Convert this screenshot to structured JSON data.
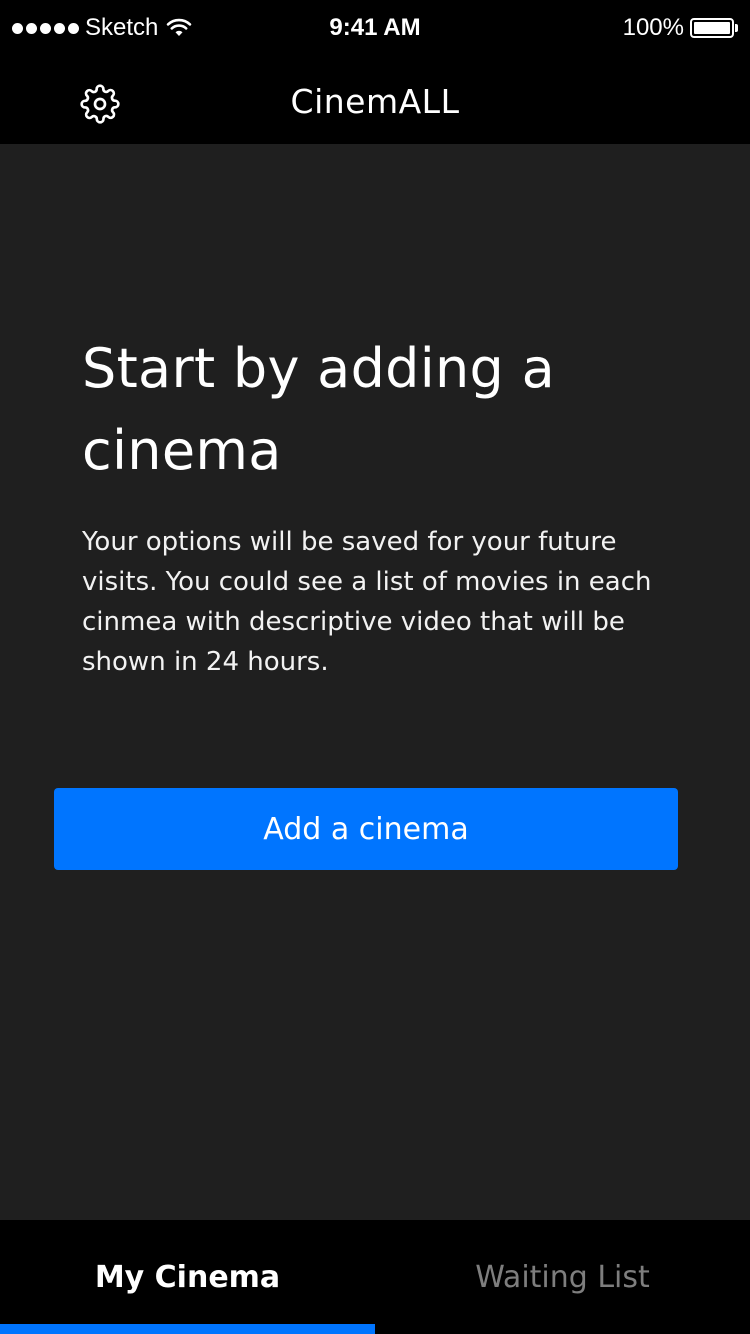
{
  "status_bar": {
    "carrier": "Sketch",
    "time": "9:41 AM",
    "battery_percent": "100%",
    "battery_level": 1.0
  },
  "nav": {
    "title": "CinemALL",
    "settings_icon": "gear-icon"
  },
  "empty_state": {
    "headline": "Start by adding a cinema",
    "description": "Your options will be saved for your future visits. You could see a list of movies in each cinmea with descriptive video that will be shown in 24 hours.",
    "add_button_label": "Add a cinema"
  },
  "tabs": [
    {
      "label": "My Cinema",
      "active": true
    },
    {
      "label": "Waiting List",
      "active": false
    }
  ],
  "colors": {
    "accent": "#0075ff",
    "background": "#1f1f1f",
    "bars": "#000000",
    "inactive_tab": "#7e7e7e"
  }
}
